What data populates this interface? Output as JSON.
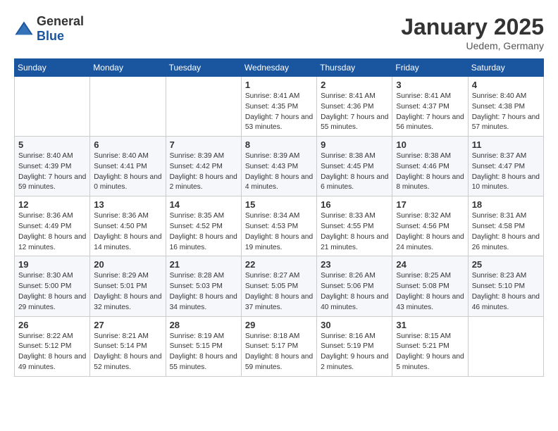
{
  "logo": {
    "general": "General",
    "blue": "Blue"
  },
  "header": {
    "title": "January 2025",
    "subtitle": "Uedem, Germany"
  },
  "weekdays": [
    "Sunday",
    "Monday",
    "Tuesday",
    "Wednesday",
    "Thursday",
    "Friday",
    "Saturday"
  ],
  "weeks": [
    [
      {
        "day": "",
        "info": ""
      },
      {
        "day": "",
        "info": ""
      },
      {
        "day": "",
        "info": ""
      },
      {
        "day": "1",
        "info": "Sunrise: 8:41 AM\nSunset: 4:35 PM\nDaylight: 7 hours and 53 minutes."
      },
      {
        "day": "2",
        "info": "Sunrise: 8:41 AM\nSunset: 4:36 PM\nDaylight: 7 hours and 55 minutes."
      },
      {
        "day": "3",
        "info": "Sunrise: 8:41 AM\nSunset: 4:37 PM\nDaylight: 7 hours and 56 minutes."
      },
      {
        "day": "4",
        "info": "Sunrise: 8:40 AM\nSunset: 4:38 PM\nDaylight: 7 hours and 57 minutes."
      }
    ],
    [
      {
        "day": "5",
        "info": "Sunrise: 8:40 AM\nSunset: 4:39 PM\nDaylight: 7 hours and 59 minutes."
      },
      {
        "day": "6",
        "info": "Sunrise: 8:40 AM\nSunset: 4:41 PM\nDaylight: 8 hours and 0 minutes."
      },
      {
        "day": "7",
        "info": "Sunrise: 8:39 AM\nSunset: 4:42 PM\nDaylight: 8 hours and 2 minutes."
      },
      {
        "day": "8",
        "info": "Sunrise: 8:39 AM\nSunset: 4:43 PM\nDaylight: 8 hours and 4 minutes."
      },
      {
        "day": "9",
        "info": "Sunrise: 8:38 AM\nSunset: 4:45 PM\nDaylight: 8 hours and 6 minutes."
      },
      {
        "day": "10",
        "info": "Sunrise: 8:38 AM\nSunset: 4:46 PM\nDaylight: 8 hours and 8 minutes."
      },
      {
        "day": "11",
        "info": "Sunrise: 8:37 AM\nSunset: 4:47 PM\nDaylight: 8 hours and 10 minutes."
      }
    ],
    [
      {
        "day": "12",
        "info": "Sunrise: 8:36 AM\nSunset: 4:49 PM\nDaylight: 8 hours and 12 minutes."
      },
      {
        "day": "13",
        "info": "Sunrise: 8:36 AM\nSunset: 4:50 PM\nDaylight: 8 hours and 14 minutes."
      },
      {
        "day": "14",
        "info": "Sunrise: 8:35 AM\nSunset: 4:52 PM\nDaylight: 8 hours and 16 minutes."
      },
      {
        "day": "15",
        "info": "Sunrise: 8:34 AM\nSunset: 4:53 PM\nDaylight: 8 hours and 19 minutes."
      },
      {
        "day": "16",
        "info": "Sunrise: 8:33 AM\nSunset: 4:55 PM\nDaylight: 8 hours and 21 minutes."
      },
      {
        "day": "17",
        "info": "Sunrise: 8:32 AM\nSunset: 4:56 PM\nDaylight: 8 hours and 24 minutes."
      },
      {
        "day": "18",
        "info": "Sunrise: 8:31 AM\nSunset: 4:58 PM\nDaylight: 8 hours and 26 minutes."
      }
    ],
    [
      {
        "day": "19",
        "info": "Sunrise: 8:30 AM\nSunset: 5:00 PM\nDaylight: 8 hours and 29 minutes."
      },
      {
        "day": "20",
        "info": "Sunrise: 8:29 AM\nSunset: 5:01 PM\nDaylight: 8 hours and 32 minutes."
      },
      {
        "day": "21",
        "info": "Sunrise: 8:28 AM\nSunset: 5:03 PM\nDaylight: 8 hours and 34 minutes."
      },
      {
        "day": "22",
        "info": "Sunrise: 8:27 AM\nSunset: 5:05 PM\nDaylight: 8 hours and 37 minutes."
      },
      {
        "day": "23",
        "info": "Sunrise: 8:26 AM\nSunset: 5:06 PM\nDaylight: 8 hours and 40 minutes."
      },
      {
        "day": "24",
        "info": "Sunrise: 8:25 AM\nSunset: 5:08 PM\nDaylight: 8 hours and 43 minutes."
      },
      {
        "day": "25",
        "info": "Sunrise: 8:23 AM\nSunset: 5:10 PM\nDaylight: 8 hours and 46 minutes."
      }
    ],
    [
      {
        "day": "26",
        "info": "Sunrise: 8:22 AM\nSunset: 5:12 PM\nDaylight: 8 hours and 49 minutes."
      },
      {
        "day": "27",
        "info": "Sunrise: 8:21 AM\nSunset: 5:14 PM\nDaylight: 8 hours and 52 minutes."
      },
      {
        "day": "28",
        "info": "Sunrise: 8:19 AM\nSunset: 5:15 PM\nDaylight: 8 hours and 55 minutes."
      },
      {
        "day": "29",
        "info": "Sunrise: 8:18 AM\nSunset: 5:17 PM\nDaylight: 8 hours and 59 minutes."
      },
      {
        "day": "30",
        "info": "Sunrise: 8:16 AM\nSunset: 5:19 PM\nDaylight: 9 hours and 2 minutes."
      },
      {
        "day": "31",
        "info": "Sunrise: 8:15 AM\nSunset: 5:21 PM\nDaylight: 9 hours and 5 minutes."
      },
      {
        "day": "",
        "info": ""
      }
    ]
  ]
}
